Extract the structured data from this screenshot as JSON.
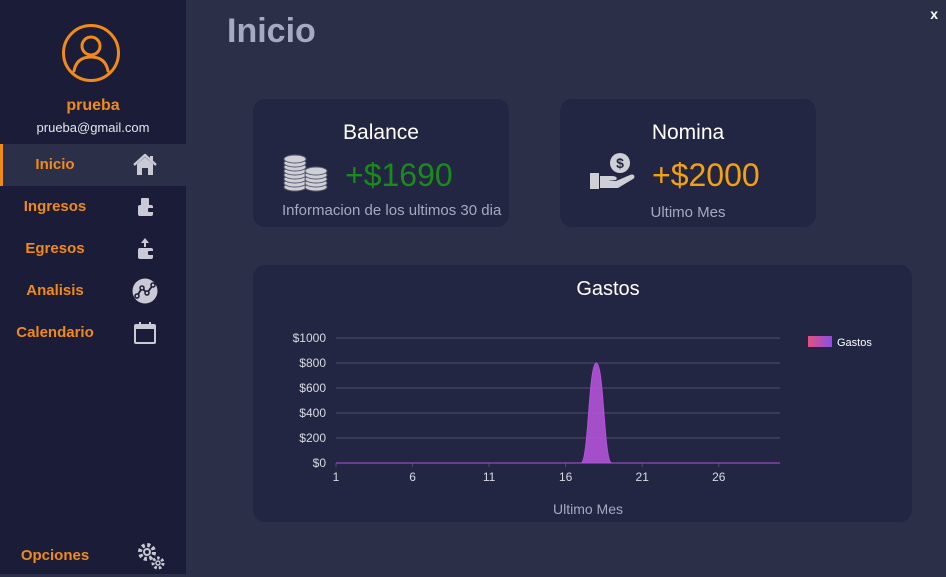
{
  "page": {
    "title": "Inicio",
    "close_label": "x"
  },
  "user": {
    "name": "prueba",
    "email": "prueba@gmail.com"
  },
  "sidebar": {
    "items": [
      {
        "label": "Inicio",
        "icon": "home-icon"
      },
      {
        "label": "Ingresos",
        "icon": "wallet-in-icon"
      },
      {
        "label": "Egresos",
        "icon": "wallet-out-icon"
      },
      {
        "label": "Analisis",
        "icon": "analytics-icon"
      },
      {
        "label": "Calendario",
        "icon": "calendar-icon"
      }
    ],
    "options_label": "Opciones",
    "active_index": 0
  },
  "cards": {
    "balance": {
      "title": "Balance",
      "amount": "+$1690",
      "subtitle": "Informacion de los ultimos 30 dia",
      "icon": "coins-icon",
      "color": "#1a8a1a"
    },
    "nomina": {
      "title": "Nomina",
      "amount": "+$2000",
      "subtitle": "Ultimo Mes",
      "icon": "salary-hand-icon",
      "color": "#f5a10f"
    }
  },
  "colors": {
    "accent": "#f08a1a",
    "sidebar_bg": "#1b1d38",
    "main_bg": "#2c2f48",
    "card_bg": "#232643"
  },
  "chart_data": {
    "type": "area",
    "title": "Gastos",
    "xlabel": "Ultimo Mes",
    "ylabel": "",
    "x_ticks": [
      "1",
      "6",
      "11",
      "16",
      "21",
      "26"
    ],
    "y_ticks": [
      "$0",
      "$200",
      "$400",
      "$600",
      "$800",
      "$1000"
    ],
    "xlim": [
      1,
      30
    ],
    "ylim": [
      0,
      1000
    ],
    "legend_position": "top-right",
    "grid": true,
    "series": [
      {
        "name": "Gastos",
        "color": "#b353d9",
        "x": [
          1,
          2,
          3,
          4,
          5,
          6,
          7,
          8,
          9,
          10,
          11,
          12,
          13,
          14,
          15,
          16,
          17,
          18,
          19,
          20,
          21,
          22,
          23,
          24,
          25,
          26,
          27,
          28,
          29,
          30
        ],
        "values": [
          0,
          0,
          0,
          0,
          0,
          0,
          0,
          0,
          0,
          0,
          0,
          0,
          0,
          0,
          0,
          0,
          0,
          800,
          0,
          0,
          0,
          0,
          0,
          0,
          0,
          0,
          0,
          0,
          0,
          0
        ]
      }
    ]
  }
}
